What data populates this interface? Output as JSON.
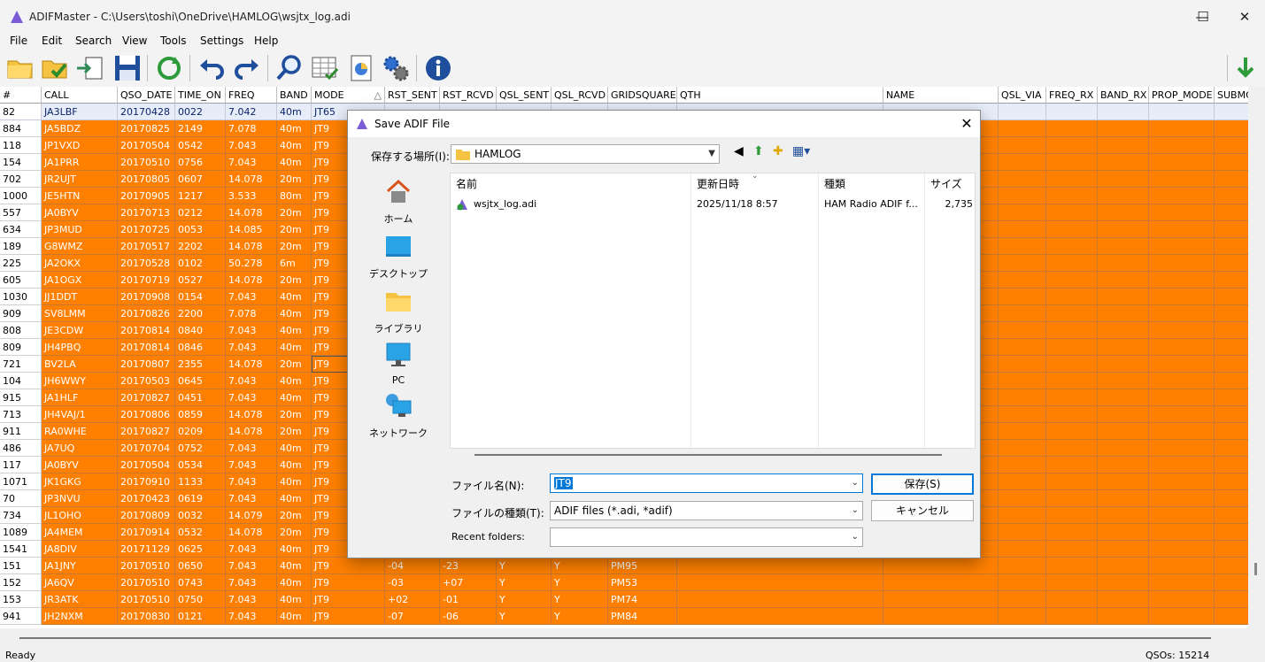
{
  "window": {
    "title": "ADIFMaster - C:\\Users\\toshi\\OneDrive\\HAMLOG\\wsjtx_log.adi",
    "minimize": "—",
    "maximize": "☐",
    "close": "✕"
  },
  "menu": [
    "File",
    "Edit",
    "Search",
    "View",
    "Tools",
    "Settings",
    "Help"
  ],
  "toolbar": [
    "open-folder-icon",
    "open-check-icon",
    "export-icon",
    "save-icon",
    "refresh-icon",
    "undo-icon",
    "redo-icon",
    "search-icon",
    "table-edit-icon",
    "chart-icon",
    "settings-icon",
    "info-icon",
    "download-arrow-icon"
  ],
  "grid": {
    "columns": [
      "#",
      "CALL",
      "QSO_DATE",
      "TIME_ON",
      "FREQ",
      "BAND",
      "MODE",
      "RST_SENT",
      "RST_RCVD",
      "QSL_SENT",
      "QSL_RCVD",
      "GRIDSQUARE",
      "QTH",
      "NAME",
      "QSL_VIA",
      "FREQ_RX",
      "BAND_RX",
      "PROP_MODE",
      "SUBMC"
    ],
    "sort_indicator": "△",
    "rows": [
      [
        "82",
        "JA3LBF",
        "20170428",
        "0022",
        "7.042",
        "40m",
        "JT65",
        "",
        "",
        "",
        "",
        "",
        "",
        "",
        "",
        "",
        "",
        "",
        ""
      ],
      [
        "884",
        "JA5BDZ",
        "20170825",
        "2149",
        "7.078",
        "40m",
        "JT9",
        "",
        "",
        "",
        "",
        "",
        "",
        "",
        "",
        "",
        "",
        "",
        ""
      ],
      [
        "118",
        "JP1VXD",
        "20170504",
        "0542",
        "7.043",
        "40m",
        "JT9",
        "",
        "",
        "",
        "",
        "",
        "",
        "",
        "",
        "",
        "",
        "",
        ""
      ],
      [
        "154",
        "JA1PRR",
        "20170510",
        "0756",
        "7.043",
        "40m",
        "JT9",
        "",
        "",
        "",
        "",
        "",
        "",
        "",
        "",
        "",
        "",
        "",
        ""
      ],
      [
        "702",
        "JR2UJT",
        "20170805",
        "0607",
        "14.078",
        "20m",
        "JT9",
        "",
        "",
        "",
        "",
        "",
        "",
        "",
        "",
        "",
        "",
        "",
        ""
      ],
      [
        "1000",
        "JE5HTN",
        "20170905",
        "1217",
        "3.533",
        "80m",
        "JT9",
        "",
        "",
        "",
        "",
        "",
        "",
        "",
        "",
        "",
        "",
        "",
        ""
      ],
      [
        "557",
        "JA0BYV",
        "20170713",
        "0212",
        "14.078",
        "20m",
        "JT9",
        "",
        "",
        "",
        "",
        "",
        "",
        "",
        "",
        "",
        "",
        "",
        ""
      ],
      [
        "634",
        "JP3MUD",
        "20170725",
        "0053",
        "14.085",
        "20m",
        "JT9",
        "",
        "",
        "",
        "",
        "",
        "",
        "",
        "",
        "",
        "",
        "",
        ""
      ],
      [
        "189",
        "G8WMZ",
        "20170517",
        "2202",
        "14.078",
        "20m",
        "JT9",
        "",
        "",
        "",
        "",
        "",
        "",
        "",
        "",
        "",
        "",
        "",
        ""
      ],
      [
        "225",
        "JA2OKX",
        "20170528",
        "0102",
        "50.278",
        "6m",
        "JT9",
        "",
        "",
        "",
        "",
        "",
        "",
        "",
        "",
        "",
        "",
        "",
        ""
      ],
      [
        "605",
        "JA1OGX",
        "20170719",
        "0527",
        "14.078",
        "20m",
        "JT9",
        "",
        "",
        "",
        "",
        "",
        "",
        "",
        "",
        "",
        "",
        "",
        ""
      ],
      [
        "1030",
        "JJ1DDT",
        "20170908",
        "0154",
        "7.043",
        "40m",
        "JT9",
        "",
        "",
        "",
        "",
        "",
        "",
        "",
        "",
        "",
        "",
        "",
        ""
      ],
      [
        "909",
        "SV8LMM",
        "20170826",
        "2200",
        "7.078",
        "40m",
        "JT9",
        "",
        "",
        "",
        "",
        "",
        "",
        "",
        "",
        "",
        "",
        "",
        ""
      ],
      [
        "808",
        "JE3CDW",
        "20170814",
        "0840",
        "7.043",
        "40m",
        "JT9",
        "",
        "",
        "",
        "",
        "",
        "",
        "",
        "",
        "",
        "",
        "",
        ""
      ],
      [
        "809",
        "JH4PBQ",
        "20170814",
        "0846",
        "7.043",
        "40m",
        "JT9",
        "",
        "",
        "",
        "",
        "",
        "",
        "",
        "",
        "",
        "",
        "",
        ""
      ],
      [
        "721",
        "BV2LA",
        "20170807",
        "2355",
        "14.078",
        "20m",
        "JT9",
        "",
        "",
        "",
        "",
        "",
        "",
        "",
        "",
        "",
        "",
        "",
        ""
      ],
      [
        "104",
        "JH6WWY",
        "20170503",
        "0645",
        "7.043",
        "40m",
        "JT9",
        "",
        "",
        "",
        "",
        "",
        "",
        "",
        "",
        "",
        "",
        "",
        ""
      ],
      [
        "915",
        "JA1HLF",
        "20170827",
        "0451",
        "7.043",
        "40m",
        "JT9",
        "",
        "",
        "",
        "",
        "",
        "",
        "",
        "",
        "",
        "",
        "",
        ""
      ],
      [
        "713",
        "JH4VAJ/1",
        "20170806",
        "0859",
        "14.078",
        "20m",
        "JT9",
        "",
        "",
        "",
        "",
        "",
        "",
        "",
        "",
        "",
        "",
        "",
        ""
      ],
      [
        "911",
        "RA0WHE",
        "20170827",
        "0209",
        "14.078",
        "20m",
        "JT9",
        "",
        "",
        "",
        "",
        "",
        "",
        "",
        "",
        "",
        "",
        "",
        ""
      ],
      [
        "486",
        "JA7UQ",
        "20170704",
        "0752",
        "7.043",
        "40m",
        "JT9",
        "",
        "",
        "",
        "",
        "",
        "",
        "",
        "",
        "",
        "",
        "",
        ""
      ],
      [
        "117",
        "JA0BYV",
        "20170504",
        "0534",
        "7.043",
        "40m",
        "JT9",
        "",
        "",
        "",
        "",
        "",
        "",
        "",
        "",
        "",
        "",
        "",
        ""
      ],
      [
        "1071",
        "JK1GKG",
        "20170910",
        "1133",
        "7.043",
        "40m",
        "JT9",
        "",
        "",
        "",
        "",
        "",
        "",
        "",
        "",
        "",
        "",
        "",
        ""
      ],
      [
        "70",
        "JP3NVU",
        "20170423",
        "0619",
        "7.043",
        "40m",
        "JT9",
        "",
        "",
        "",
        "",
        "",
        "",
        "",
        "",
        "",
        "",
        "",
        ""
      ],
      [
        "734",
        "JL1OHO",
        "20170809",
        "0032",
        "14.079",
        "20m",
        "JT9",
        "",
        "",
        "",
        "",
        "",
        "",
        "",
        "",
        "",
        "",
        "",
        ""
      ],
      [
        "1089",
        "JA4MEM",
        "20170914",
        "0532",
        "14.078",
        "20m",
        "JT9",
        "",
        "",
        "",
        "",
        "",
        "",
        "",
        "",
        "",
        "",
        "",
        ""
      ],
      [
        "1541",
        "JA8DIV",
        "20171129",
        "0625",
        "7.043",
        "40m",
        "JT9",
        "",
        "",
        "",
        "",
        "",
        "",
        "",
        "",
        "",
        "",
        "",
        ""
      ],
      [
        "151",
        "JA1JNY",
        "20170510",
        "0650",
        "7.043",
        "40m",
        "JT9",
        "-04",
        "-23",
        "Y",
        "Y",
        "PM95",
        "",
        "",
        "",
        "",
        "",
        "",
        ""
      ],
      [
        "152",
        "JA6QV",
        "20170510",
        "0743",
        "7.043",
        "40m",
        "JT9",
        "-03",
        "+07",
        "Y",
        "Y",
        "PM53",
        "",
        "",
        "",
        "",
        "",
        "",
        ""
      ],
      [
        "153",
        "JR3ATK",
        "20170510",
        "0750",
        "7.043",
        "40m",
        "JT9",
        "+02",
        "-01",
        "Y",
        "Y",
        "PM74",
        "",
        "",
        "",
        "",
        "",
        "",
        ""
      ],
      [
        "941",
        "JH2NXM",
        "20170830",
        "0121",
        "7.043",
        "40m",
        "JT9",
        "-07",
        "-06",
        "Y",
        "Y",
        "PM84",
        "",
        "",
        "",
        "",
        "",
        "",
        ""
      ]
    ]
  },
  "status": {
    "left": "Ready",
    "right": "QSOs: 15214"
  },
  "dialog": {
    "title": "Save ADIF File",
    "close": "✕",
    "save_in_label": "保存する場所(I):",
    "save_in_value": "HAMLOG",
    "places": [
      "ホーム",
      "デスクトップ",
      "ライブラリ",
      "PC",
      "ネットワーク"
    ],
    "file_columns": [
      "名前",
      "更新日時",
      "種類",
      "サイズ"
    ],
    "files": [
      {
        "name": "wsjtx_log.adi",
        "modified": "2025/11/18 8:57",
        "type": "HAM Radio ADIF f...",
        "size": "2,735"
      }
    ],
    "filename_label": "ファイル名(N):",
    "filename_value": "JT9",
    "filetype_label": "ファイルの種類(T):",
    "filetype_value": "ADIF files (*.adi, *adif)",
    "recent_label": "Recent folders:",
    "recent_value": "",
    "save_button": "保存(S)",
    "cancel_button": "キャンセル"
  }
}
